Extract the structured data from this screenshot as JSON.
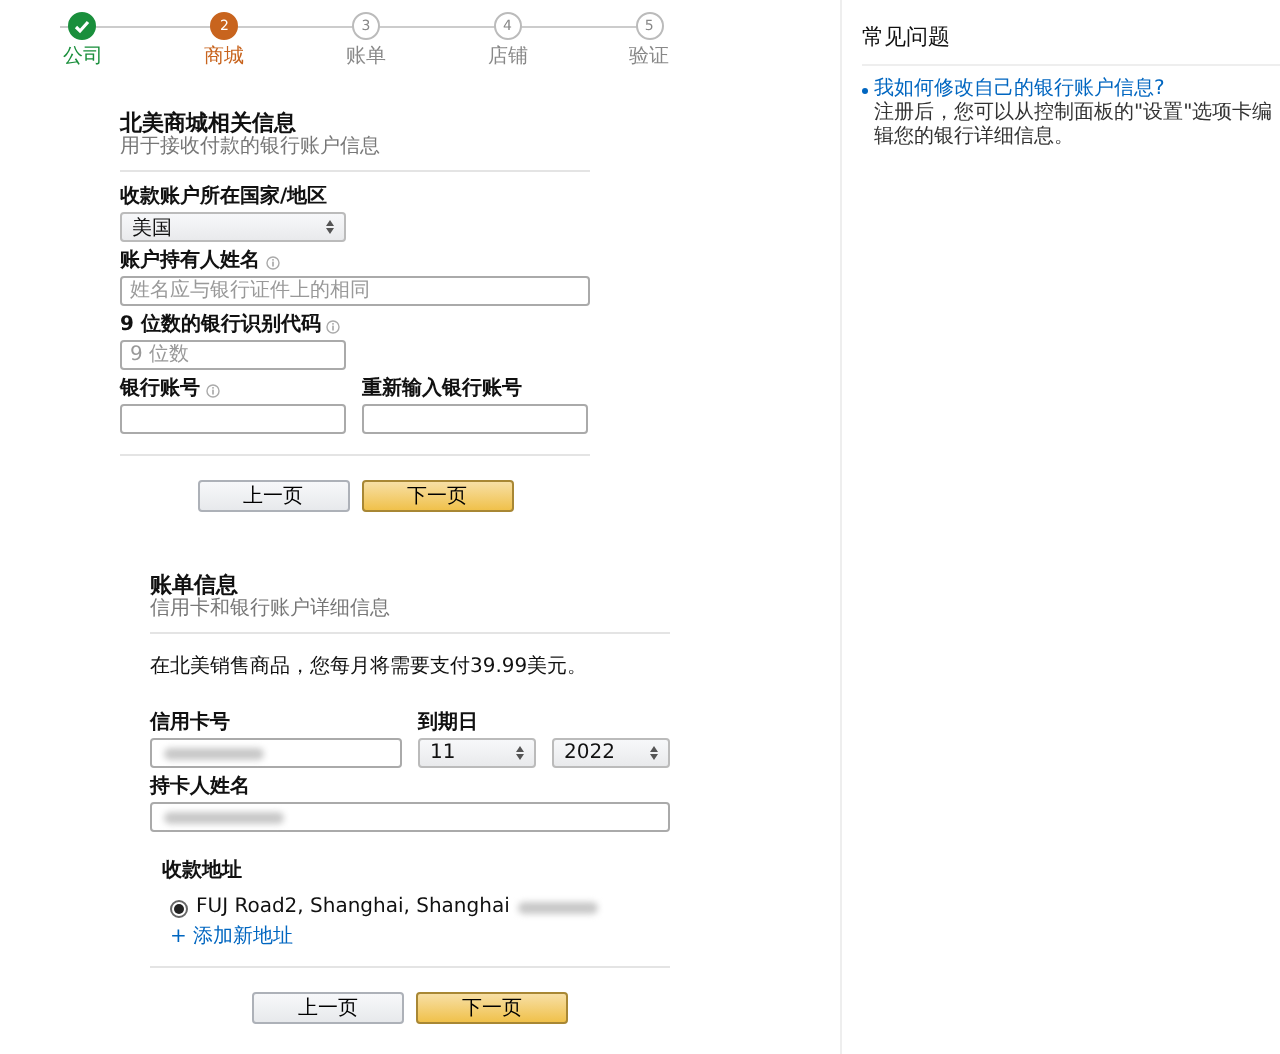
{
  "steps": [
    {
      "kind": "done",
      "label": "公司"
    },
    {
      "kind": "current",
      "number": "2",
      "label": "商城"
    },
    {
      "kind": "todo",
      "number": "3",
      "label": "账单"
    },
    {
      "kind": "todo",
      "number": "4",
      "label": "店铺"
    },
    {
      "kind": "todo",
      "number": "5",
      "label": "验证"
    }
  ],
  "faq": {
    "title": "常见问题",
    "items": [
      {
        "question": "我如何修改自己的银行账户信息?",
        "answer": "注册后，您可以从控制面板的\"设置\"选项卡编辑您的银行详细信息。"
      }
    ]
  },
  "bank_section": {
    "title": "北美商城相关信息",
    "subtitle": "用于接收付款的银行账户信息",
    "country": {
      "label": "收款账户所在国家/地区",
      "value": "美国"
    },
    "holder": {
      "label": "账户持有人姓名",
      "placeholder": "姓名应与银行证件上的相同"
    },
    "routing": {
      "label": "9 位数的银行识别代码",
      "placeholder": "9 位数"
    },
    "account": {
      "label": "银行账号"
    },
    "account_repeat": {
      "label": "重新输入银行账号"
    },
    "buttons": [
      {
        "kind": "secondary",
        "label": "上一页"
      },
      {
        "kind": "primary",
        "label": "下一页"
      }
    ]
  },
  "billing_section": {
    "title": "账单信息",
    "subtitle": "信用卡和银行账户详细信息",
    "notice": "在北美销售商品，您每月将需要支付39.99美元。",
    "card_number": {
      "label": "信用卡号",
      "blurred": true
    },
    "expiry": {
      "label": "到期日",
      "month": "11",
      "year": "2022"
    },
    "card_holder": {
      "label": "持卡人姓名",
      "blurred": true
    },
    "address": {
      "label": "收款地址",
      "options": [
        {
          "text": "FUJ Road2, Shanghai, Shanghai",
          "selected": true
        }
      ],
      "add_link": "+ 添加新地址"
    },
    "buttons": [
      {
        "kind": "secondary",
        "label": "上一页"
      },
      {
        "kind": "primary",
        "label": "下一页"
      }
    ]
  }
}
